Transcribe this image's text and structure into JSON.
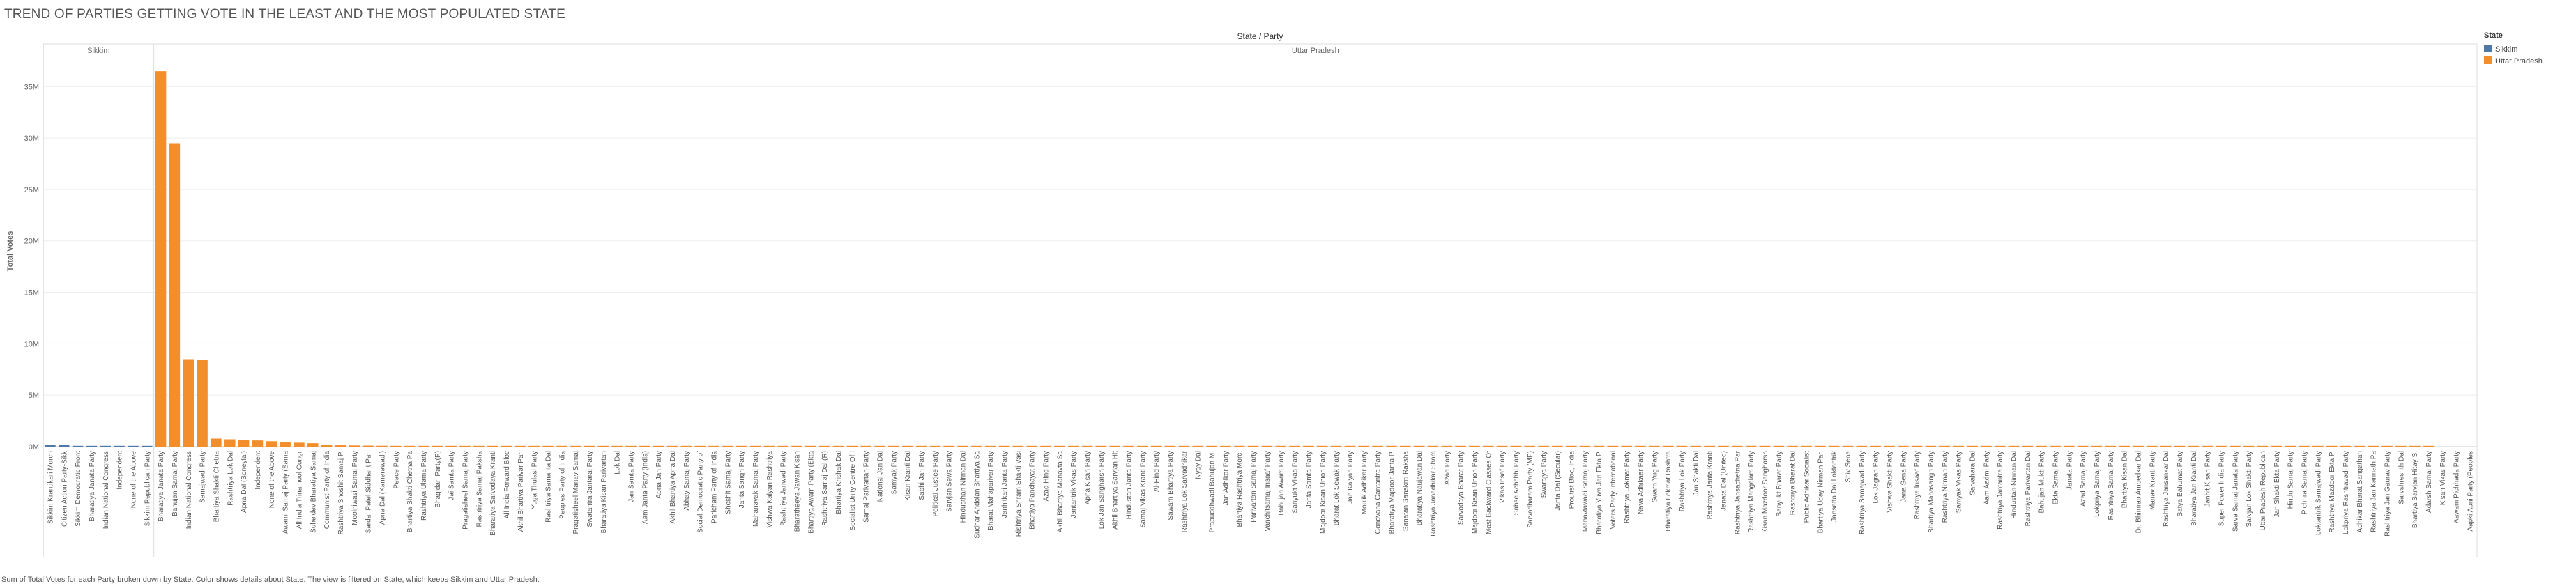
{
  "title": "TREND OF PARTIES GETTING VOTE IN THE LEAST AND THE MOST POPULATED STATE",
  "caption": "Sum of Total Votes for each Party broken down by State.  Color shows details about State. The view is filtered on State, which keeps Sikkim and Uttar Pradesh.",
  "colors": {
    "Sikkim": "#4e79a7",
    "Uttar Pradesh": "#f28e2b"
  },
  "chart_data": {
    "type": "bar",
    "header": "State / Party",
    "ylabel": "Total Votes",
    "ylim": [
      0,
      38000000
    ],
    "yticks": [
      0,
      5000000,
      10000000,
      15000000,
      20000000,
      25000000,
      30000000,
      35000000
    ],
    "ytick_labels": [
      "0M",
      "5M",
      "10M",
      "15M",
      "20M",
      "25M",
      "30M",
      "35M"
    ],
    "legend": {
      "title": "State",
      "position": "right",
      "items": [
        "Sikkim",
        "Uttar Pradesh"
      ]
    },
    "panels": [
      {
        "state": "Sikkim",
        "categories": [
          "Sikkim Krantikari Morch",
          "Citizen Action Party-Sikk",
          "Sikkim Democratic Front",
          "Bharatiya Janata Party",
          "Indian National Congress",
          "Independent",
          "None of the Above",
          "Sikkim Republican Party"
        ],
        "values": [
          166922,
          154489,
          3000,
          2000,
          1000,
          500,
          300,
          100
        ]
      },
      {
        "state": "Uttar Pradesh",
        "categories": [
          "Bharatiya Janata Party",
          "Bahujan Samaj Party",
          "Indian National Congress",
          "Samajwadi Party",
          "Bhartiya Shakti Chetna",
          "Rashtriya Lok Dal",
          "Apna Dal (Soneylal)",
          "Independent",
          "None of the Above",
          "Awami Samaj Party (Sama",
          "All India Trinamool Congr",
          "Suheldev Bharatiya Samaj",
          "Communist Party of India",
          "Rashtriya Shoshit Samaj P.",
          "Moolniwasi Samaj Party",
          "Sardar Patel Siddhant Par.",
          "Apna Dal (Kamerawadi)",
          "Peace Party",
          "Bhartiya Shakti Chetna Pa",
          "Rashtriya Ulama Party",
          "Bhagidari Party(P)",
          "Jai Samta Party",
          "Pragatisheel Samaj Party",
          "Rashtriya Samaj Paksha",
          "Bharatiya Sarvodaya Kranti",
          "All India Forward Bloc",
          "Akhil Bhartiya Parivar Par.",
          "Yuga Thulasi Party",
          "Rashtriya Samanta Dal",
          "Peoples Party of India",
          "Pragatisheel Manav Samaj",
          "Swatantra Jantaraj Party",
          "Bharatiya Kisan Parivartan",
          "Lok Dal",
          "Jan Samta Party",
          "Aam Janta Party (India)",
          "Apna Jan Party",
          "Akhil Bhartiya Apna Dal",
          "Abhay Samaj Party",
          "Social Democratic Party of",
          "Paricham Party of India",
          "Shoshit Samaj Party",
          "Janta Sangh Party",
          "Mahanayak Samaj Party",
          "Vishwa Kalyan Rashtriya",
          "Rashtriya Janwadi Party",
          "Bharatheeya Jawan Kisan",
          "Bhartiya Awam Party (Ekta",
          "Rashtriya Samaj Dal (R)",
          "Bhartiya Krishak Dal",
          "Socialist Unity Centre Of I",
          "Samaj Parivartan Party",
          "National Jan Dal",
          "Samyak Party",
          "Kisan Kranti Dal",
          "Sabhi Jan Party",
          "Political Justice Party",
          "Sarvjan Sewa Party",
          "Hindusthan Nirman Dal",
          "Sudhar Andolan Bhartiya Sa",
          "Bharat Mahaparivar Party",
          "Janhitkari Janta Party",
          "Rishtriya Shram Shakti Vasi",
          "Bhartiya Panchayat Party",
          "Azad Hind Party",
          "Akhil Bhartiya Manavta Sa",
          "Jantantrik Vikas Party",
          "Apna Kisan Party",
          "Lok Jan Sangharsh Party",
          "Akhil Bhartiya Sarvjan Hit",
          "Hindustan Janta Party",
          "Samaj Vikas Kranti Party",
          "Al-Hind Party",
          "Sawarn Bhartiya Party",
          "Rashtriya Lok Sarvadhikar",
          "Nyay Dal",
          "Prabuddhwadi Bahujan M.",
          "Jan Adhikar Party",
          "Bhartiya Rashtriya Morc.",
          "Parivartan Samaj Party",
          "Vanchitsamaj Insaaf Party",
          "Bahujan Awam Party",
          "Sanyukt Vikas Party",
          "Janta Samta Party",
          "Majdoor Kisan Union Party",
          "Bharat Lok Sewak Party",
          "Jan Kalyan Party",
          "Moulik Adhikar Party",
          "Gondvana Gantantra Party",
          "Bharatiya Majdoor Janta P.",
          "Sanatan Sanskriti Raksha",
          "Bharatiya Naujawan Dal",
          "Rashtriya Janadhikar Sham",
          "Azad Party",
          "Sarvodaya Bharat Party",
          "Majdoor Kisan Union Party",
          "Most Backward Classes Of",
          "Vikas Insaf Party",
          "Sabse Achchhi Party",
          "Sarvadharam Party (MP)",
          "Swarajya Party",
          "Janta Dal (Secular)",
          "Proutist Bloc, India",
          "Manavtawadi Samaj Party",
          "Bharatiya Yuva Jan Ekta P.",
          "Voters Party International",
          "Rashtriya Lokmat Party",
          "Nava Adhikaar Party",
          "Swarn Yug Party",
          "Bharatiya Lokmat Rashtra",
          "Rashtriya Lok Party",
          "Jan Shakti Dal",
          "Rashtriya Janta Kranti",
          "Janata Dal (United)",
          "Rashtriya Jansachetna Par",
          "Rashtriya Mangalam Party",
          "Kisan Mazdoor Sangharsh",
          "Sanyukt Bharat Party",
          "Rashtriya Bharat Dal",
          "Public Adhikar Socialist",
          "Bhartiya Uday Nirman Par.",
          "Jansatta Dal Loktantrik",
          "Shiv Sena",
          "Rashtriya Samajwadi Party",
          "Lok Jagran Party",
          "Vishwa Shakti Party",
          "Jana Sena Party",
          "Rashtriya Insaaf Party",
          "Bhartiya Mahasangh Party",
          "Rashtriya Nirman Party",
          "Samyak Vikas Party",
          "Sarvahara Dal",
          "Aam Aadmi Party",
          "Rashtriya Jantantra Party",
          "Hindustan Nirman Dal",
          "Rashtriya Parivartan Dal",
          "Bahujan Mukti Party",
          "Ekta Samaj Party",
          "Janata Party",
          "Azad Samaj Party",
          "Lokpriya Samaj Party",
          "Rashtriya Samaj Party",
          "Bhartiya Kisan Dal",
          "Dr. Bhimrao Ambedkar Dal",
          "Manav Kranti Party",
          "Rashtriya Jansankar Dal",
          "Satya Bahumat Party",
          "Bharatiya Jan Kranti Dal",
          "Janhit Kisan Party",
          "Super Power India Party",
          "Sarva Samaj Janata Party",
          "Sarvjan Lok Shakti Party",
          "Uttar Pradesh Republican",
          "Jan Shakti Ekta Party",
          "Hindu Samaj Party",
          "Pichhra Samaj Party",
          "Loktantrik Samajwadi Party",
          "Rashtriya Mazdoor Ekta P.",
          "Lokpriya Rashtravadi Party",
          "Adhikar Bharat Sangathan",
          "Rashtriya Jan Karmath Pa",
          "Rashtriya Jan Gaurav Party",
          "Sarvshreshth Dal",
          "Bhartiya Sarvjan Hitay S.",
          "Adarsh Samaj Party",
          "Kisan Vikas Party",
          "Aawam Pichhada Party",
          "Aapki Apni Party (Peoples"
        ],
        "values": [
          36500000,
          29500000,
          8500000,
          8400000,
          780000,
          710000,
          660000,
          600000,
          520000,
          470000,
          380000,
          330000,
          150000,
          130000,
          115000,
          100000,
          90000,
          82000,
          70000,
          62000,
          55000,
          50000,
          45000,
          41000,
          38000,
          35000,
          32000,
          30000,
          28000,
          26000,
          24000,
          22000,
          21000,
          20000,
          19000,
          18000,
          17000,
          16000,
          15000,
          14500,
          14000,
          13500,
          13000,
          12500,
          12000,
          11500,
          11000,
          10500,
          10000,
          9800,
          9600,
          9400,
          9200,
          9000,
          8800,
          8600,
          8400,
          8200,
          8000,
          7800,
          7600,
          7400,
          7200,
          7000,
          6800,
          6600,
          6400,
          6200,
          6000,
          5800,
          5600,
          5400,
          5200,
          5000,
          4900,
          4800,
          4700,
          4600,
          4500,
          4400,
          4300,
          4200,
          4100,
          4000,
          3900,
          3800,
          3700,
          3600,
          3500,
          3400,
          3300,
          3200,
          3100,
          3000,
          2950,
          2900,
          2850,
          2800,
          2750,
          2700,
          2650,
          2600,
          2550,
          2500,
          2450,
          2400,
          2350,
          2300,
          2250,
          2200,
          2150,
          2100,
          2050,
          2000,
          1950,
          1900,
          1850,
          1800,
          1750,
          1700,
          1650,
          1600,
          1550,
          1500,
          1450,
          1400,
          1350,
          1300,
          1250,
          1200,
          1150,
          1100,
          1050,
          1000,
          980,
          960,
          940,
          920,
          900,
          880,
          860,
          840,
          820,
          800,
          780,
          760,
          740,
          720,
          700,
          680,
          660,
          640,
          620,
          600,
          580,
          560,
          540,
          520,
          500,
          480,
          460,
          440,
          420,
          400,
          380
        ]
      }
    ]
  }
}
